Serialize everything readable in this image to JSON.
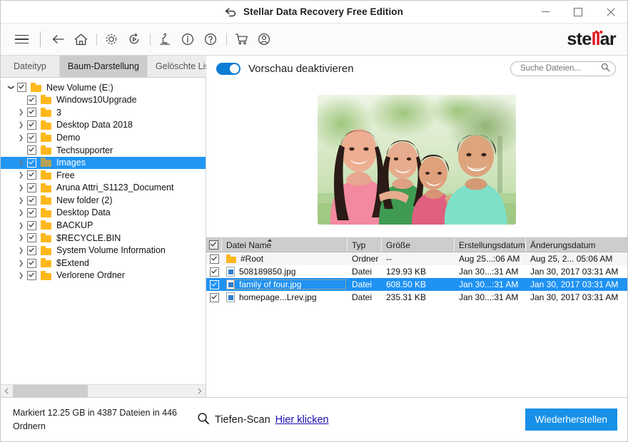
{
  "window": {
    "title": "Stellar Data Recovery Free Edition",
    "back_icon": "back-arrow-icon",
    "minimize_label": "—",
    "maximize_label": "□",
    "close_label": "✕"
  },
  "toolbar": {
    "icons": [
      {
        "name": "menu-icon",
        "label": "☰"
      },
      {
        "name": "back-icon",
        "label": "←"
      },
      {
        "name": "home-icon",
        "label": "⌂"
      },
      {
        "name": "settings-gear-icon",
        "label": "⚙"
      },
      {
        "name": "history-icon",
        "label": "↺"
      },
      {
        "name": "microscope-icon",
        "label": "⚗"
      },
      {
        "name": "info-icon",
        "label": "i"
      },
      {
        "name": "help-icon",
        "label": "?"
      },
      {
        "name": "cart-icon",
        "label": "Ὥ2"
      },
      {
        "name": "account-icon",
        "label": "○"
      }
    ],
    "logo_part1": "ste",
    "logo_red": "ll",
    "logo_part2": "ar"
  },
  "tabs": [
    {
      "label": "Dateityp",
      "active": false
    },
    {
      "label": "Baum-Darstellung",
      "active": true
    },
    {
      "label": "Gelöschte Liste",
      "active": false
    }
  ],
  "tree": {
    "items": [
      {
        "label": "New Volume (E:)",
        "indent": 0,
        "arrow": "down",
        "checked": true,
        "selected": false
      },
      {
        "label": "Windows10Upgrade",
        "indent": 1,
        "arrow": "none",
        "checked": true,
        "selected": false
      },
      {
        "label": "3",
        "indent": 1,
        "arrow": "right",
        "checked": true,
        "selected": false
      },
      {
        "label": "Desktop Data 2018",
        "indent": 1,
        "arrow": "right",
        "checked": true,
        "selected": false
      },
      {
        "label": "Demo",
        "indent": 1,
        "arrow": "right",
        "checked": true,
        "selected": false
      },
      {
        "label": "Techsupporter",
        "indent": 1,
        "arrow": "none",
        "checked": true,
        "selected": false
      },
      {
        "label": "Images",
        "indent": 1,
        "arrow": "right",
        "checked": true,
        "selected": true
      },
      {
        "label": "Free",
        "indent": 1,
        "arrow": "right",
        "checked": true,
        "selected": false
      },
      {
        "label": "Aruna Attri_S1123_Document",
        "indent": 1,
        "arrow": "right",
        "checked": true,
        "selected": false
      },
      {
        "label": "New folder (2)",
        "indent": 1,
        "arrow": "right",
        "checked": true,
        "selected": false
      },
      {
        "label": "Desktop Data",
        "indent": 1,
        "arrow": "right",
        "checked": true,
        "selected": false
      },
      {
        "label": "BACKUP",
        "indent": 1,
        "arrow": "right",
        "checked": true,
        "selected": false
      },
      {
        "label": "$RECYCLE.BIN",
        "indent": 1,
        "arrow": "right",
        "checked": true,
        "selected": false
      },
      {
        "label": "System Volume Information",
        "indent": 1,
        "arrow": "right",
        "checked": true,
        "selected": false
      },
      {
        "label": "$Extend",
        "indent": 1,
        "arrow": "right",
        "checked": true,
        "selected": false
      },
      {
        "label": "Verlorene Ordner",
        "indent": 1,
        "arrow": "right",
        "checked": true,
        "selected": false
      }
    ]
  },
  "preview": {
    "toggle_label": "Vorschau deaktivieren",
    "toggle_on": true,
    "image_alt": "family of four photo preview"
  },
  "search": {
    "placeholder": "Suche Dateien...",
    "value": "",
    "icon": "search-icon"
  },
  "table": {
    "headers": {
      "name": "Datei Name",
      "type": "Typ",
      "size": "Größe",
      "created": "Erstellungsdatum",
      "modified": "Änderungsdatum"
    },
    "sort_column": "name",
    "sort_direction": "asc",
    "rows": [
      {
        "icon": "folder-icon",
        "name": "#Root",
        "type": "Ordner",
        "size": "--",
        "created": "Aug 25...:06 AM",
        "modified": "Aug 25, 2... 05:06 AM",
        "checked": true,
        "selected": false
      },
      {
        "icon": "image-file-icon",
        "name": "508189850.jpg",
        "type": "Datei",
        "size": "129.93 KB",
        "created": "Jan 30...:31 AM",
        "modified": "Jan 30, 2017 03:31 AM",
        "checked": true,
        "selected": false
      },
      {
        "icon": "image-file-icon",
        "name": "family of four.jpg",
        "type": "Datei",
        "size": "608.50 KB",
        "created": "Jan 30...:31 AM",
        "modified": "Jan 30, 2017 03:31 AM",
        "checked": true,
        "selected": true
      },
      {
        "icon": "image-file-icon",
        "name": "homepage...Lrev.jpg",
        "type": "Datei",
        "size": "235.31 KB",
        "created": "Jan 30...:31 AM",
        "modified": "Jan 30, 2017 03:31 AM",
        "checked": true,
        "selected": false
      }
    ]
  },
  "status": {
    "marked_text": "Markiert 12.25 GB in 4387 Dateien in 446 Ordnern",
    "deep_scan_label": "Tiefen-Scan",
    "deep_scan_link": "Hier klicken",
    "deep_scan_icon": "magnifier-icon",
    "recover_button": "Wiederherstellen"
  },
  "colors": {
    "accent": "#1790e8",
    "selection": "#1f92f2",
    "brand_red": "#e01b22",
    "folder": "#ffb81c",
    "link": "#1a0dab"
  }
}
